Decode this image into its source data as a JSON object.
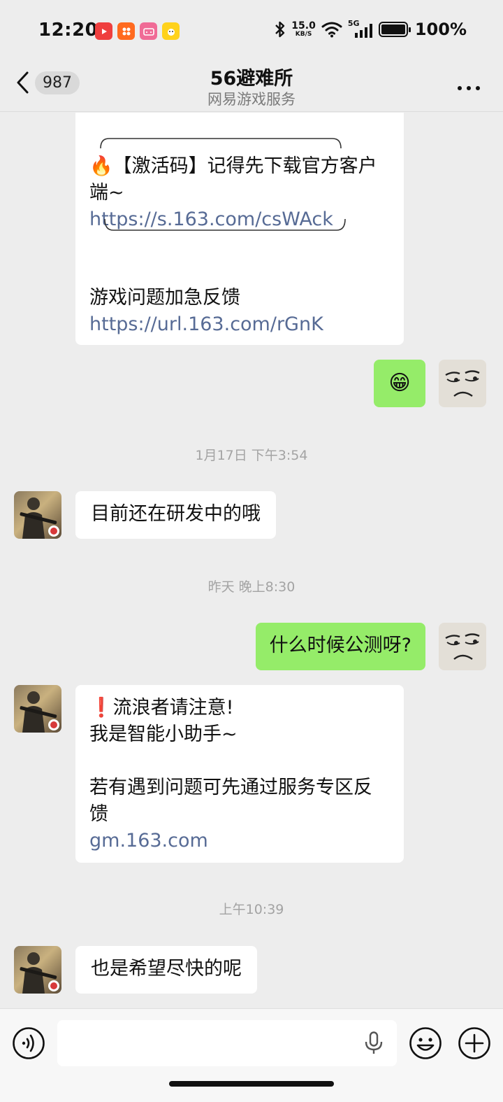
{
  "status_bar": {
    "time": "12:20",
    "net_speed_value": "15.0",
    "net_speed_unit": "KB/S",
    "network": "5G",
    "battery": "100%"
  },
  "header": {
    "unread_count": "987",
    "title": "56避难所",
    "subtitle": "网易游戏服务"
  },
  "messages": [
    {
      "side": "left",
      "lines": [
        "🔥【激活码】记得先下载官方客户",
        "端~"
      ],
      "link1": "https://s.163.com/csWAck",
      "line3": "游戏问题加急反馈",
      "link2": "https://url.163.com/rGnK"
    },
    {
      "side": "right",
      "emoji": "😁"
    },
    {
      "type": "time",
      "text": "1月17日 下午3:54"
    },
    {
      "side": "left",
      "text": "目前还在研发中的哦"
    },
    {
      "type": "time",
      "text": "昨天 晚上8:30"
    },
    {
      "side": "right",
      "text": "什么时候公测呀?"
    },
    {
      "side": "left",
      "line1": "❗流浪者请注意!",
      "line2": "我是智能小助手~",
      "line3": "若有遇到问题可先通过服务专区反",
      "line4": "馈",
      "link": "gm.163.com"
    },
    {
      "type": "time",
      "text": "上午10:39"
    },
    {
      "side": "left",
      "text": "也是希望尽快的呢"
    }
  ],
  "colors": {
    "background": "#ededed",
    "bubble_self": "#95ec69",
    "bubble_other": "#ffffff",
    "link": "#576b95"
  }
}
